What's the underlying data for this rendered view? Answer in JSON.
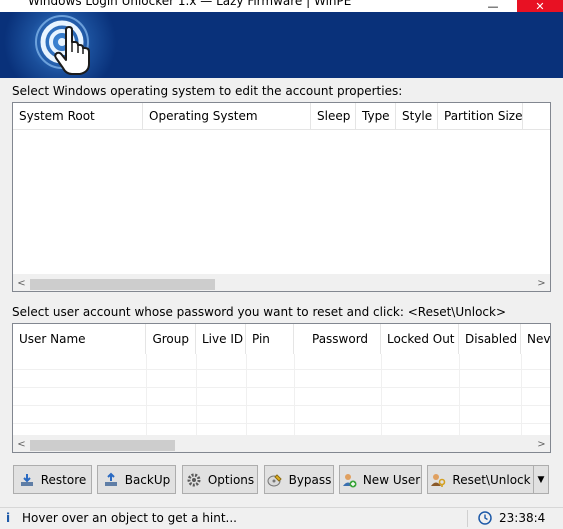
{
  "window": {
    "title": "Windows Login Unlocker 1.x — Lazy Firmware | WinPE",
    "minimize_glyph": "—",
    "close_glyph": "✕"
  },
  "os_section": {
    "label": "Select Windows operating system to edit the account properties:",
    "columns": [
      "System Root",
      "Operating System",
      "Sleep",
      "Type",
      "Style",
      "Partition Size"
    ],
    "rows": []
  },
  "user_section": {
    "label": "Select user account whose password you want to reset and click: <Reset\\Unlock>",
    "columns": [
      "User Name",
      "Group",
      "Live ID",
      "Pin",
      "Password",
      "Locked Out",
      "Disabled",
      "Neve"
    ],
    "rows": []
  },
  "scroll": {
    "left_arrow": "<",
    "right_arrow": ">"
  },
  "buttons": {
    "restore": "Restore",
    "backup": "BackUp",
    "options": "Options",
    "bypass": "Bypass",
    "new_user": "New User",
    "reset_unlock": "Reset\\Unlock",
    "dropdown_glyph": "▼"
  },
  "status": {
    "info_glyph": "i",
    "hint": "Hover over an object to get a hint...",
    "time": "23:38:4"
  },
  "colors": {
    "banner": "#09317a",
    "close": "#e81123",
    "button_face": "#e1e1e1"
  },
  "icons": {
    "banner": "touch-hand-icon",
    "restore": "restore-download-icon",
    "backup": "backup-upload-icon",
    "options": "gear-icon",
    "bypass": "bypass-disk-icon",
    "new_user": "add-user-icon",
    "reset_unlock": "user-key-icon",
    "clock": "clock-icon"
  }
}
